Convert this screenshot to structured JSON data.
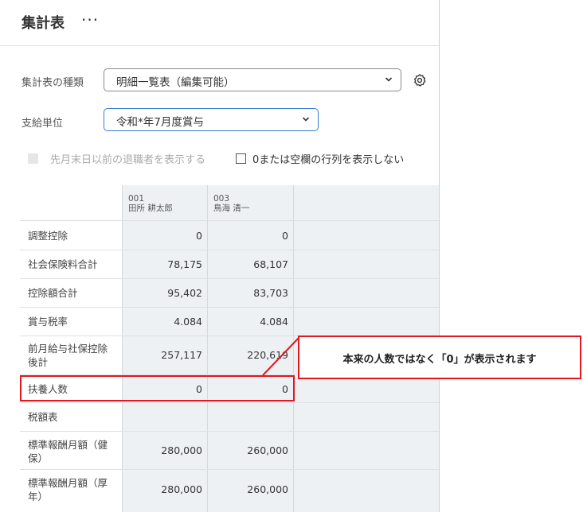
{
  "header": {
    "title": "集計表",
    "more_label": "···"
  },
  "filters": {
    "type_label": "集計表の種類",
    "type_value": "明細一覧表（編集可能）",
    "unit_label": "支給単位",
    "unit_value": "令和*年7月度賞与",
    "show_retired_label": "先月末日以前の退職者を表示する",
    "hide_zero_label": "0または空欄の行列を表示しない"
  },
  "employees": [
    {
      "code": "001",
      "name": "田所 耕太郎"
    },
    {
      "code": "003",
      "name": "鳥海 清一"
    }
  ],
  "rows": [
    {
      "label": "調整控除",
      "a": "0",
      "b": "0"
    },
    {
      "label": "社会保険料合計",
      "a": "78,175",
      "b": "68,107"
    },
    {
      "label": "控除額合計",
      "a": "95,402",
      "b": "83,703"
    },
    {
      "label": "賞与税率",
      "a": "4.084",
      "b": "4.084"
    },
    {
      "label": "前月給与社保控除後計",
      "a": "257,117",
      "b": "220,619"
    },
    {
      "label": "扶養人数",
      "a": "0",
      "b": "0"
    },
    {
      "label": "税額表",
      "a": "",
      "b": ""
    },
    {
      "label": "標準報酬月額（健保）",
      "a": "280,000",
      "b": "260,000"
    },
    {
      "label": "標準報酬月額（厚年）",
      "a": "280,000",
      "b": "260,000"
    }
  ],
  "callout": {
    "text": "本来の人数ではなく「0」が表示されます",
    "color": "#e0191e"
  },
  "colors": {
    "accent": "#3a7bd5",
    "grid_bg": "#eef1f4"
  }
}
